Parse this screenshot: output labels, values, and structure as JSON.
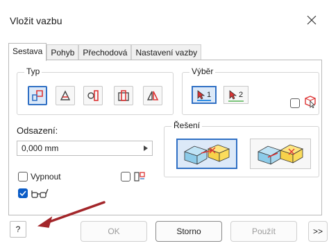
{
  "window": {
    "title": "Vložit vazbu",
    "close_glyph": "✕"
  },
  "tabs": [
    {
      "label": "Sestava",
      "active": true
    },
    {
      "label": "Pohyb",
      "active": false
    },
    {
      "label": "Přechodová",
      "active": false
    },
    {
      "label": "Nastavení vazby",
      "active": false
    }
  ],
  "type_group": {
    "label": "Typ",
    "buttons": [
      {
        "icon": "mate-constraint-icon",
        "selected": true
      },
      {
        "icon": "angle-constraint-icon",
        "selected": false
      },
      {
        "icon": "tangent-constraint-icon",
        "selected": false
      },
      {
        "icon": "insert-constraint-icon",
        "selected": false
      },
      {
        "icon": "symmetry-constraint-icon",
        "selected": false
      }
    ]
  },
  "selection_group": {
    "label": "Výběr",
    "buttons": [
      {
        "num": "1",
        "icon": "select-cursor-icon",
        "selected": true,
        "color": "#2f8de4"
      },
      {
        "num": "2",
        "icon": "select-cursor-icon",
        "selected": false,
        "color": "#7cc57c"
      }
    ],
    "pick_part_first_checked": false
  },
  "offset": {
    "label": "Odsazení:",
    "value": "0,000 mm"
  },
  "solution_group": {
    "label": "Řešení",
    "options": [
      {
        "icon": "mate-solution-icon",
        "selected": true
      },
      {
        "icon": "flush-solution-icon",
        "selected": false
      }
    ]
  },
  "options": {
    "vypnout": {
      "label": "Vypnout",
      "checked": false
    },
    "predict_offset_checked": false,
    "show_preview_checked": true
  },
  "footer": {
    "help": "?",
    "ok": "OK",
    "storno": "Storno",
    "pouzit": "Použít",
    "more": ">>"
  },
  "colors": {
    "accent": "#2f6fc4",
    "annotation_arrow": "#a3262a"
  }
}
